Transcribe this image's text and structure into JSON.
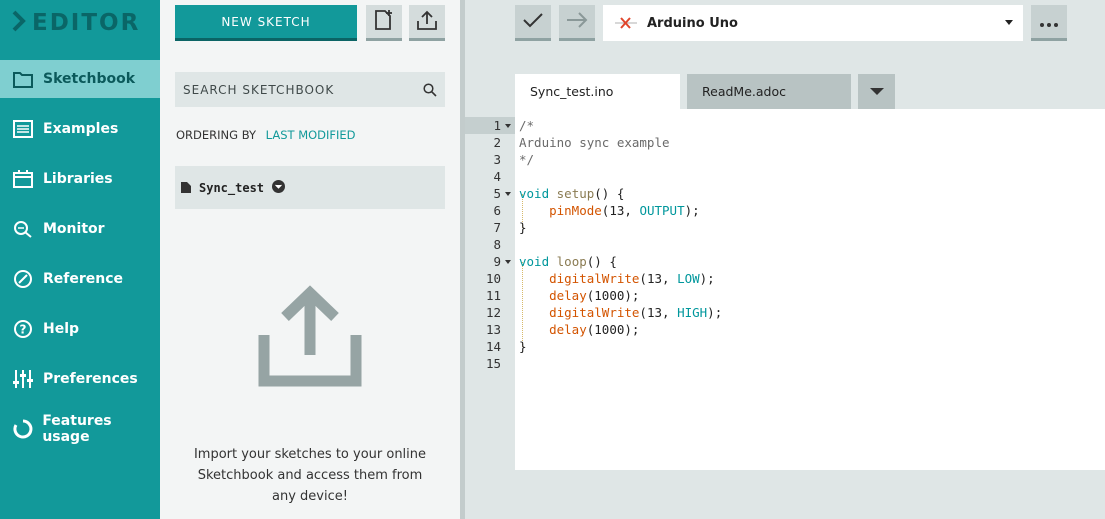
{
  "app": {
    "logo_text": "EDITOR"
  },
  "nav": {
    "items": [
      {
        "label": "Sketchbook",
        "icon": "folder-icon",
        "active": true
      },
      {
        "label": "Examples",
        "icon": "list-icon"
      },
      {
        "label": "Libraries",
        "icon": "library-icon"
      },
      {
        "label": "Monitor",
        "icon": "monitor-icon"
      },
      {
        "label": "Reference",
        "icon": "compass-icon"
      },
      {
        "label": "Help",
        "icon": "help-icon"
      },
      {
        "label": "Preferences",
        "icon": "sliders-icon"
      },
      {
        "label": "Features usage",
        "icon": "usage-ring-icon"
      }
    ]
  },
  "sketchbook": {
    "new_sketch_label": "NEW SKETCH",
    "new_file_icon": "new-folder-icon",
    "upload_icon": "upload-icon",
    "search_placeholder": "SEARCH SKETCHBOOK",
    "ordering_label": "ORDERING BY",
    "ordering_value": "LAST MODIFIED",
    "sketches": [
      {
        "name": "Sync_test"
      }
    ],
    "import_text": "Import your sketches to your online Sketchbook and access them from any device!"
  },
  "toolbar": {
    "verify_icon": "checkmark-icon",
    "upload_icon": "arrow-right-icon",
    "board_status_icon": "disconnected-icon",
    "board_name": "Arduino Uno",
    "more_icon": "more-icon"
  },
  "tabs": [
    {
      "label": "Sync_test.ino",
      "active": true
    },
    {
      "label": "ReadMe.adoc",
      "active": false
    }
  ],
  "editor": {
    "line_numbers": [
      "1",
      "2",
      "3",
      "4",
      "5",
      "6",
      "7",
      "8",
      "9",
      "10",
      "11",
      "12",
      "13",
      "14",
      "15"
    ],
    "current_line": 1,
    "lines": [
      [
        {
          "t": "/*",
          "c": "cm"
        }
      ],
      [
        {
          "t": "Arduino sync example",
          "c": "cm"
        }
      ],
      [
        {
          "t": "*/",
          "c": "cm"
        }
      ],
      [],
      [
        {
          "t": "void",
          "c": "kw"
        },
        {
          "t": " ",
          "c": "pn"
        },
        {
          "t": "setup",
          "c": "nm"
        },
        {
          "t": "() {",
          "c": "pn"
        }
      ],
      [
        {
          "t": "    ",
          "c": "pn"
        },
        {
          "t": "pinMode",
          "c": "fn"
        },
        {
          "t": "(13, ",
          "c": "pn"
        },
        {
          "t": "OUTPUT",
          "c": "ct"
        },
        {
          "t": ");",
          "c": "pn"
        }
      ],
      [
        {
          "t": "}",
          "c": "pn"
        }
      ],
      [],
      [
        {
          "t": "void",
          "c": "kw"
        },
        {
          "t": " ",
          "c": "pn"
        },
        {
          "t": "loop",
          "c": "nm"
        },
        {
          "t": "() {",
          "c": "pn"
        }
      ],
      [
        {
          "t": "    ",
          "c": "pn"
        },
        {
          "t": "digitalWrite",
          "c": "fn"
        },
        {
          "t": "(13, ",
          "c": "pn"
        },
        {
          "t": "LOW",
          "c": "ct"
        },
        {
          "t": ");",
          "c": "pn"
        }
      ],
      [
        {
          "t": "    ",
          "c": "pn"
        },
        {
          "t": "delay",
          "c": "fn"
        },
        {
          "t": "(1000);",
          "c": "pn"
        }
      ],
      [
        {
          "t": "    ",
          "c": "pn"
        },
        {
          "t": "digitalWrite",
          "c": "fn"
        },
        {
          "t": "(13, ",
          "c": "pn"
        },
        {
          "t": "HIGH",
          "c": "ct"
        },
        {
          "t": ");",
          "c": "pn"
        }
      ],
      [
        {
          "t": "    ",
          "c": "pn"
        },
        {
          "t": "delay",
          "c": "fn"
        },
        {
          "t": "(1000);",
          "c": "pn"
        }
      ],
      [
        {
          "t": "}",
          "c": "pn"
        }
      ],
      []
    ],
    "fold_lines": [
      1,
      5,
      9
    ]
  },
  "colors": {
    "accent": "#12999a",
    "accent_dark": "#0b6465",
    "nav_active": "#7fcfd0",
    "panel_bg": "#f3f5f5"
  }
}
